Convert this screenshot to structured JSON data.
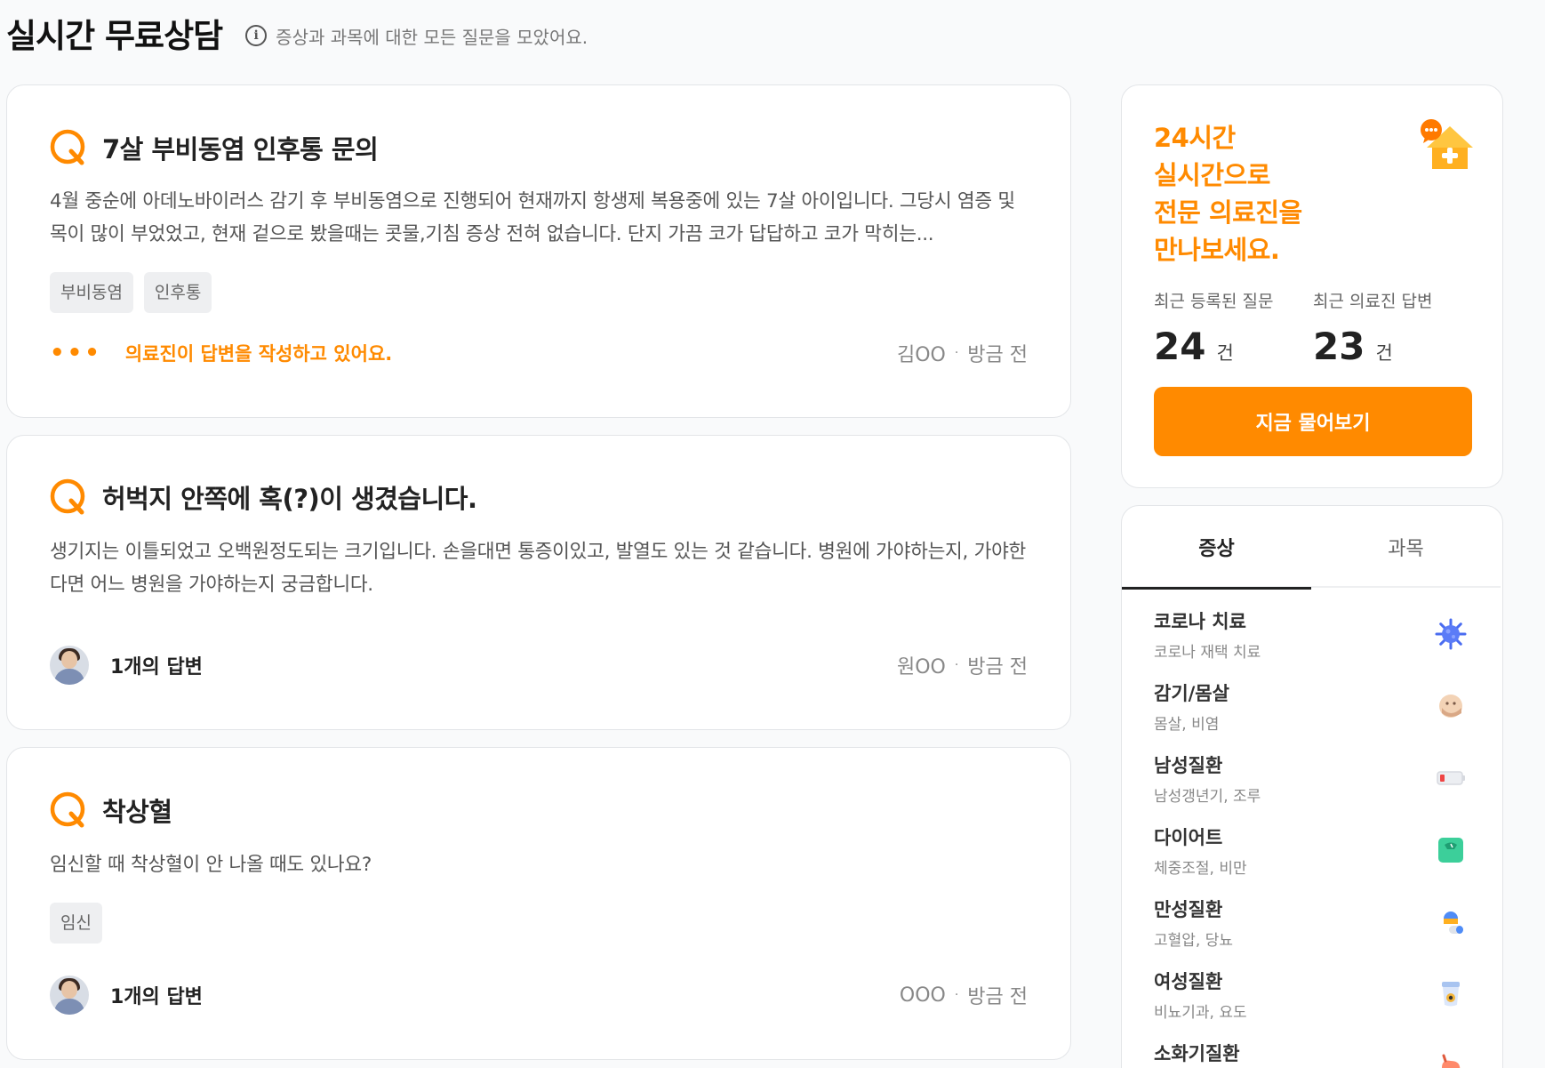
{
  "header": {
    "title": "실시간 무료상담",
    "info_icon": "info-icon",
    "description": "증상과 과목에 대한 모든 질문을 모았어요."
  },
  "questions": [
    {
      "title": "7살 부비동염 인후통 문의",
      "body": "4월 중순에 아데노바이러스 감기 후 부비동염으로 진행되어 현재까지 항생제 복용중에 있는 7살 아이입니다. 그당시 염증 및 목이 많이 부었었고, 현재 겉으로 봤을때는 콧물,기침 증상 전혀 없습니다. 단지 가끔 코가 답답하고 코가 막히는...",
      "tags": [
        "부비동염",
        "인후통"
      ],
      "status": "의료진이 답변을 작성하고 있어요.",
      "status_dots": "•••",
      "author": "김OO",
      "time": "방금 전"
    },
    {
      "title": "허벅지 안쪽에 혹(?)이 생겼습니다.",
      "body": "생기지는 이틀되었고 오백원정도되는 크기입니다. 손을대면 통증이있고, 발열도 있는 것 같습니다. 병원에 가야하는지, 가야한다면 어느 병원을 가야하는지 궁금합니다.",
      "tags": [],
      "answer_count": "1개의 답변",
      "author": "원OO",
      "time": "방금 전"
    },
    {
      "title": "착상혈",
      "body": "임신할 때 착상혈이 안 나올 때도 있나요?",
      "tags": [
        "임신"
      ],
      "answer_count": "1개의 답변",
      "author": "OOO",
      "time": "방금 전"
    }
  ],
  "meta_separator": "·",
  "promo": {
    "headline": [
      "24시간",
      "실시간으로",
      "전문 의료진을",
      "만나보세요."
    ],
    "icon": "medical-house-chat-icon",
    "stats": [
      {
        "label": "최근 등록된 질문",
        "value": "24",
        "unit": "건"
      },
      {
        "label": "최근 의료진 답변",
        "value": "23",
        "unit": "건"
      }
    ],
    "button_label": "지금 물어보기",
    "accent_color": "#ff8a00"
  },
  "category": {
    "tabs": [
      {
        "label": "증상",
        "active": true
      },
      {
        "label": "과목",
        "active": false
      }
    ],
    "items": [
      {
        "name": "코로나 치료",
        "sub": "코로나 재택 치료",
        "icon": "virus-icon"
      },
      {
        "name": "감기/몸살",
        "sub": "몸살, 비염",
        "icon": "sick-face-icon"
      },
      {
        "name": "남성질환",
        "sub": "남성갱년기, 조루",
        "icon": "low-battery-icon"
      },
      {
        "name": "다이어트",
        "sub": "체중조절, 비만",
        "icon": "scale-icon"
      },
      {
        "name": "만성질환",
        "sub": "고혈압, 당뇨",
        "icon": "pill-icon"
      },
      {
        "name": "여성질환",
        "sub": "비뇨기과, 요도",
        "icon": "cup-icon"
      },
      {
        "name": "소화기질환",
        "sub": "",
        "icon": "stomach-icon"
      }
    ]
  }
}
